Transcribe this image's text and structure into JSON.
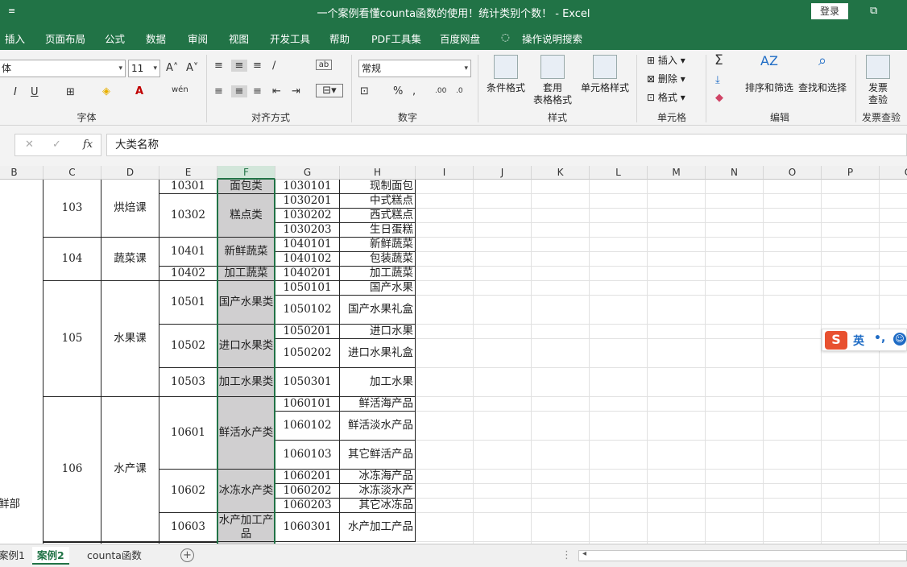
{
  "titlebar": {
    "qat_glyph": "≡",
    "title": "一个案例看懂counta函数的使用！统计类别个数！  -  Excel",
    "login": "登录",
    "window_glyph": "⧉"
  },
  "tabs": [
    "插入",
    "页面布局",
    "公式",
    "数据",
    "审阅",
    "视图",
    "开发工具",
    "帮助",
    "PDF工具集",
    "百度网盘",
    "操作说明搜索"
  ],
  "ribbon": {
    "font": {
      "name": "体",
      "size": "11",
      "label": "字体",
      "grow": "A˄",
      "shrink": "A˅",
      "italic": "I",
      "underline": "U",
      "wen": "wén"
    },
    "alignment": {
      "label": "对齐方式"
    },
    "number": {
      "format": "常规",
      "label": "数字",
      "percent": "%",
      "comma": ","
    },
    "styles": {
      "cond_format": "条件格式",
      "table_format_1": "套用",
      "table_format_2": "表格格式",
      "cell_styles": "单元格样式",
      "label": "样式"
    },
    "cells": {
      "insert": "插入",
      "delete": "删除",
      "format": "格式",
      "label": "单元格"
    },
    "editing": {
      "sum": "Σ",
      "sort_filter": "排序和筛选",
      "find_select": "查找和选择",
      "label": "编辑"
    },
    "invoice": {
      "check_1": "发票",
      "check_2": "查验",
      "label": "发票查验"
    }
  },
  "formula_bar": {
    "cancel": "✕",
    "confirm": "✓",
    "fx": "fx",
    "content": "大类名称"
  },
  "columns": [
    "B",
    "C",
    "D",
    "E",
    "F",
    "G",
    "H",
    "I",
    "J",
    "K",
    "L",
    "M",
    "N",
    "O",
    "P",
    "Q"
  ],
  "selected_column": "F",
  "table": {
    "dept": "鲜部",
    "c_codes": [
      "103",
      "104",
      "105",
      "106"
    ],
    "d_names": [
      "烘焙课",
      "蔬菜课",
      "水果课",
      "水产课"
    ],
    "e_codes": [
      "10301",
      "10302",
      "10401",
      "10402",
      "10501",
      "10502",
      "10503",
      "10601",
      "10602",
      "10603"
    ],
    "f_names": [
      "面包类",
      "糕点类",
      "新鲜蔬菜",
      "加工蔬菜",
      "国产水果类",
      "进口水果类",
      "加工水果类",
      "鲜活水产类",
      "冰冻水产类",
      "水产加工产品"
    ],
    "g_codes": [
      "1030101",
      "1030201",
      "1030202",
      "1030203",
      "1040101",
      "1040102",
      "1040201",
      "1050101",
      "1050102",
      "1050201",
      "1050202",
      "1050301",
      "1060101",
      "1060102",
      "1060103",
      "1060201",
      "1060202",
      "1060203",
      "1060301"
    ],
    "h_names": [
      "现制面包",
      "中式糕点",
      "西式糕点",
      "生日蛋糕",
      "新鲜蔬菜",
      "包装蔬菜",
      "加工蔬菜",
      "国产水果",
      "国产水果礼盒",
      "进口水果",
      "进口水果礼盒",
      "加工水果",
      "鲜活海产品",
      "鲜活淡水产品",
      "其它鲜活产品",
      "冰冻海产品",
      "冰冻淡水产",
      "其它冰冻品",
      "水产加工产品"
    ]
  },
  "ime": {
    "logo": "S",
    "lang": "英",
    "punct": "•,"
  },
  "sheet_tabs": [
    "案例1",
    "案例2",
    "counta函数"
  ],
  "active_sheet": "案例2",
  "add_sheet": "+"
}
